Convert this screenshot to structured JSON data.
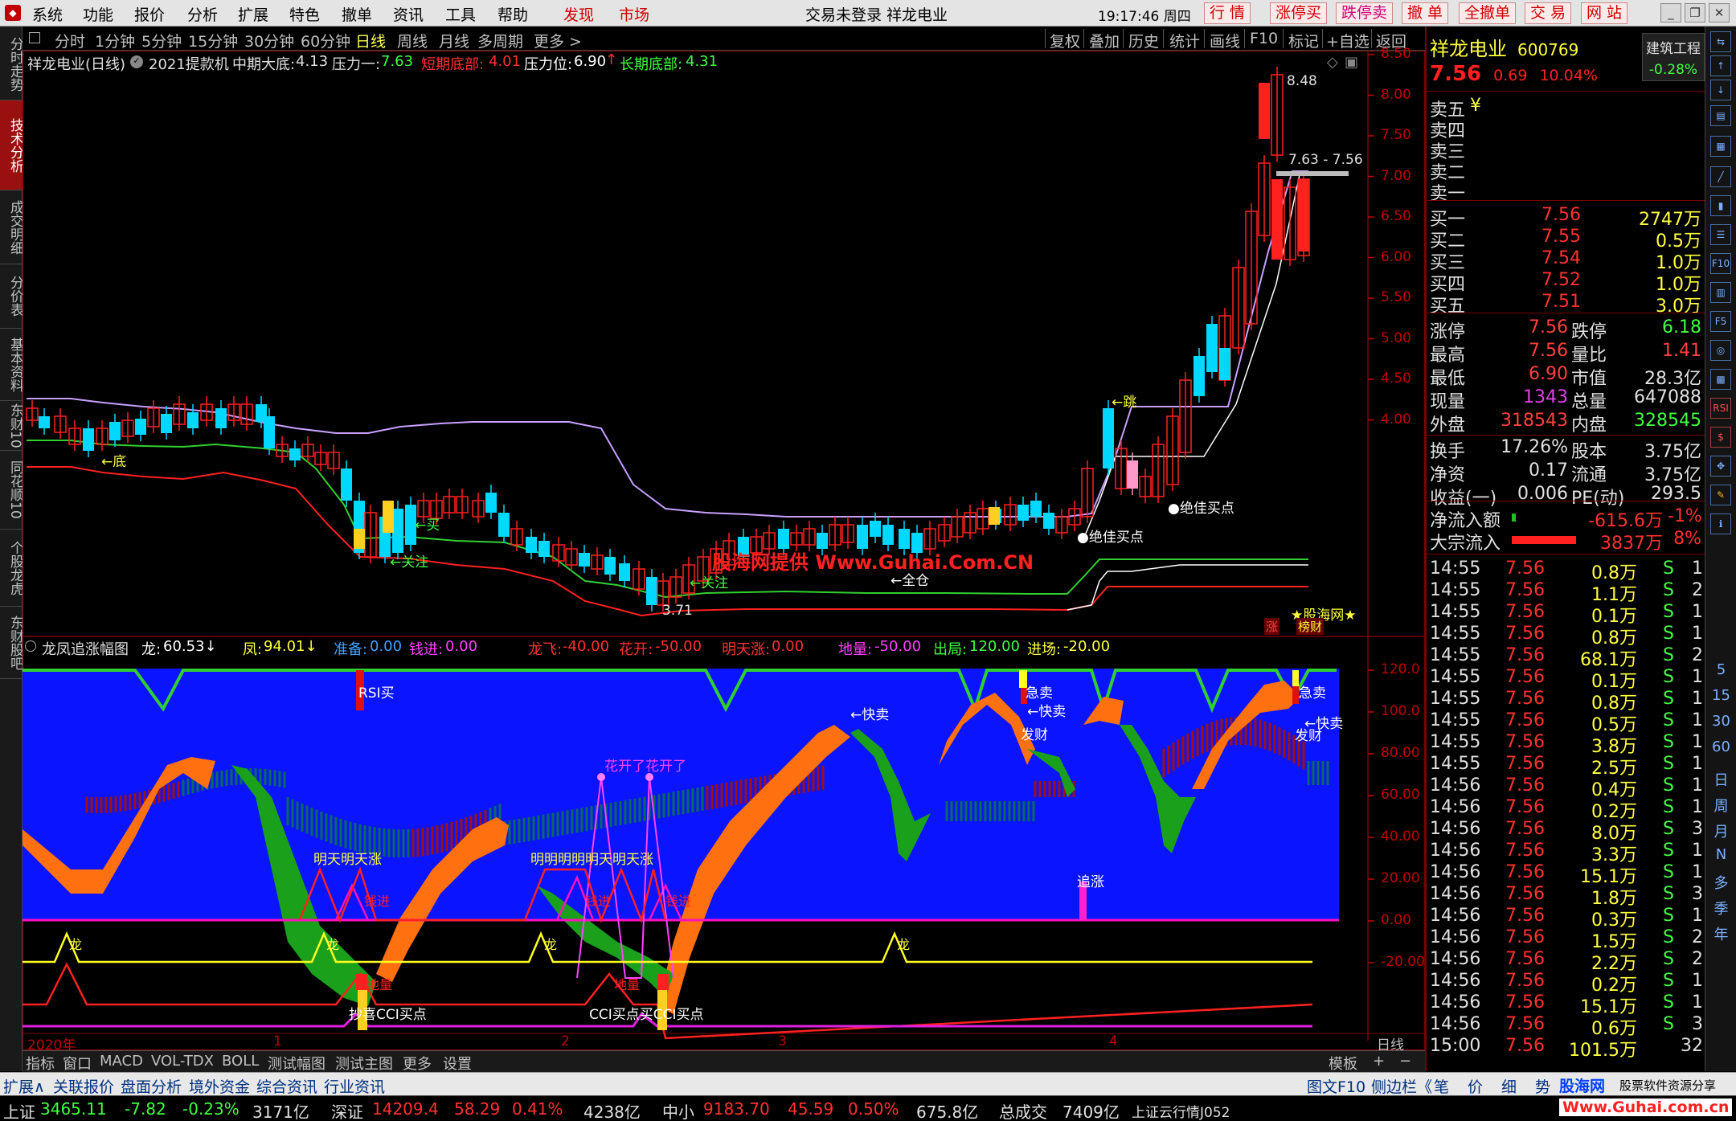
{
  "menu": {
    "items": [
      "系统",
      "功能",
      "报价",
      "分析",
      "扩展",
      "特色",
      "撤单",
      "资讯",
      "工具",
      "帮助"
    ],
    "hot": [
      "发现",
      "市场"
    ],
    "title": "交易未登录  祥龙电业",
    "time": "19:17:46 周四",
    "red_buttons": [
      "行 情",
      "涨停买",
      "跌停卖",
      "撤 单",
      "全撤单",
      "交 易",
      "网 站"
    ]
  },
  "left_tabs": [
    "分时走势",
    "技术分析",
    "成交明细",
    "分价表",
    "基本资料",
    "东财10",
    "同花顺10",
    "个股龙虎",
    "东财股吧"
  ],
  "periods": [
    "分时",
    "1分钟",
    "5分钟",
    "15分钟",
    "30分钟",
    "60分钟",
    "日线",
    "周线",
    "月线",
    "多周期",
    "更多 >"
  ],
  "tools": [
    "复权",
    "叠加",
    "历史",
    "统计",
    "画线",
    "F10",
    "标记",
    "+自选",
    "返回"
  ],
  "main_chart": {
    "stock": "祥龙电业(日线)",
    "indicator": "2021提款机",
    "mid_label": "中期大底:",
    "mid_val": "4.13",
    "pressure1_label": "压力一:",
    "pressure1_val": "7.63",
    "short_label": "短期底部:",
    "short_val": "4.01",
    "pressure_label": "压力位:",
    "pressure_val": "6.90",
    "long_label": "长期底部:",
    "long_val": "4.31",
    "price_axis": [
      "8.50",
      "8.00",
      "7.50",
      "7.00",
      "6.50",
      "6.00",
      "5.50",
      "5.00",
      "4.50",
      "4.00"
    ],
    "annotations": {
      "high": "8.48",
      "low": "3.71",
      "range": "7.63 - 7.56",
      "di": "←底",
      "mai": "←买",
      "guanzhu1": "←关注",
      "guanzhu2": "←关注",
      "quancang": "←全仓",
      "tiao": "←跳",
      "buy1": "●绝佳买点",
      "buy2": "●绝佳买点",
      "watermark": "股海网提供 Www.Guhai.Com.CN",
      "zhang": "涨",
      "guhai": "★股海网★",
      "bangcai": "榜财"
    }
  },
  "sub_chart": {
    "name": "龙凤追涨幅图",
    "long_label": "龙:",
    "long_val": "60.53↓",
    "feng_label": "凤:",
    "feng_val": "94.01↓",
    "zhunbei_label": "准备:",
    "zhunbei_val": "0.00",
    "qianjin_label": "钱进:",
    "qianjin_val": "0.00",
    "longfei_label": "龙飞:",
    "longfei_val": "-40.00",
    "huakai_label": "花开:",
    "huakai_val": "-50.00",
    "mingtian_label": "明天涨:",
    "mingtian_val": "0.00",
    "diliang_label": "地量:",
    "diliang_val": "-50.00",
    "chuju_label": "出局:",
    "chuju_val": "120.00",
    "jinchang_label": "进场:",
    "jinchang_val": "-20.00",
    "axis": [
      "120.0",
      "100.0",
      "80.00",
      "60.00",
      "40.00",
      "20.00",
      "0.00",
      "-20.00"
    ],
    "texts": {
      "rsi": "RSI买",
      "kuaimai1": "←快卖",
      "kuaimai2": "←快卖",
      "kuaimai3": "←快卖",
      "jimai1": "急卖",
      "jimai2": "急卖",
      "facai1": "发财",
      "facai2": "发财",
      "huakai": "花开了花开了",
      "mingtian1": "明天明天涨",
      "mingtian2": "明明明明明天明天涨",
      "zhuizhang": "追涨",
      "cci1": "抄喜CCI买点",
      "cci2": "CCI买点买CCI买点",
      "long1": "龙",
      "long2": "龙",
      "long3": "龙",
      "long4": "龙",
      "qian1": "钱进",
      "qian2": "钱进",
      "qian3": "钱进",
      "di1": "地量",
      "di2": "地量"
    }
  },
  "time_axis": [
    "2020年",
    "1",
    "2",
    "3",
    "4"
  ],
  "time_axis_right": "日线",
  "bottom_tabs": [
    "指标",
    "窗口",
    "MACD",
    "VOL-TDX",
    "BOLL",
    "测试幅图",
    "测试主图",
    "更多",
    "设置"
  ],
  "bottom_tabs_right": [
    "模板",
    "+",
    "−"
  ],
  "quote": {
    "name": "祥龙电业",
    "code": "600769",
    "sector": "建筑工程",
    "price": "7.56",
    "change": "0.69",
    "pct": "10.04%",
    "sector_pct": "-0.28%",
    "asks": [
      {
        "label": "卖五",
        "price": "¥",
        "vol": ""
      },
      {
        "label": "卖四",
        "price": "",
        "vol": ""
      },
      {
        "label": "卖三",
        "price": "",
        "vol": ""
      },
      {
        "label": "卖二",
        "price": "",
        "vol": ""
      },
      {
        "label": "卖一",
        "price": "",
        "vol": ""
      }
    ],
    "bids": [
      {
        "label": "买一",
        "price": "7.56",
        "vol": "2747万"
      },
      {
        "label": "买二",
        "price": "7.55",
        "vol": "0.5万"
      },
      {
        "label": "买三",
        "price": "7.54",
        "vol": "1.0万"
      },
      {
        "label": "买四",
        "price": "7.52",
        "vol": "1.0万"
      },
      {
        "label": "买五",
        "price": "7.51",
        "vol": "3.0万"
      }
    ],
    "stats": [
      {
        "l1": "涨停",
        "v1": "7.56",
        "l2": "跌停",
        "v2": "6.18",
        "c1": "#ff4040",
        "c2": "#40ff40"
      },
      {
        "l1": "最高",
        "v1": "7.56",
        "l2": "量比",
        "v2": "1.41",
        "c1": "#ff4040",
        "c2": "#ff4040"
      },
      {
        "l1": "最低",
        "v1": "6.90",
        "l2": "市值",
        "v2": "28.3亿",
        "c1": "#ff4040",
        "c2": "#e0e0e0"
      },
      {
        "l1": "现量",
        "v1": "1343",
        "l2": "总量",
        "v2": "647088",
        "c1": "#e040e0",
        "c2": "#e0e0e0"
      },
      {
        "l1": "外盘",
        "v1": "318543",
        "l2": "内盘",
        "v2": "328545",
        "c1": "#ff4040",
        "c2": "#40ff40"
      },
      {
        "l1": "换手",
        "v1": "17.26%",
        "l2": "股本",
        "v2": "3.75亿",
        "c1": "#e0e0e0",
        "c2": "#e0e0e0"
      },
      {
        "l1": "净资",
        "v1": "0.17",
        "l2": "流通",
        "v2": "3.75亿",
        "c1": "#e0e0e0",
        "c2": "#e0e0e0"
      },
      {
        "l1": "收益(一)",
        "v1": "0.006",
        "l2": "PE(动)",
        "v2": "293.5",
        "c1": "#e0e0e0",
        "c2": "#e0e0e0"
      }
    ],
    "flow": [
      {
        "label": "净流入额",
        "val": "-615.6万",
        "pct": "-1%",
        "bar": 0.05,
        "barcolor": "#20c020"
      },
      {
        "label": "大宗流入",
        "val": "3837万",
        "pct": "8%",
        "bar": 0.85,
        "barcolor": "#ff2020"
      }
    ],
    "ticks": [
      [
        "14:55",
        "7.56",
        "0.8万",
        "S",
        "1"
      ],
      [
        "14:55",
        "7.56",
        "1.1万",
        "S",
        "2"
      ],
      [
        "14:55",
        "7.56",
        "0.1万",
        "S",
        "1"
      ],
      [
        "14:55",
        "7.56",
        "0.8万",
        "S",
        "1"
      ],
      [
        "14:55",
        "7.56",
        "68.1万",
        "S",
        "2"
      ],
      [
        "14:55",
        "7.56",
        "0.1万",
        "S",
        "1"
      ],
      [
        "14:55",
        "7.56",
        "0.8万",
        "S",
        "1"
      ],
      [
        "14:55",
        "7.56",
        "0.5万",
        "S",
        "1"
      ],
      [
        "14:55",
        "7.56",
        "3.8万",
        "S",
        "1"
      ],
      [
        "14:55",
        "7.56",
        "2.5万",
        "S",
        "1"
      ],
      [
        "14:56",
        "7.56",
        "0.4万",
        "S",
        "1"
      ],
      [
        "14:56",
        "7.56",
        "0.2万",
        "S",
        "1"
      ],
      [
        "14:56",
        "7.56",
        "8.0万",
        "S",
        "3"
      ],
      [
        "14:56",
        "7.56",
        "3.3万",
        "S",
        "1"
      ],
      [
        "14:56",
        "7.56",
        "15.1万",
        "S",
        "1"
      ],
      [
        "14:56",
        "7.56",
        "1.8万",
        "S",
        "3"
      ],
      [
        "14:56",
        "7.56",
        "0.3万",
        "S",
        "1"
      ],
      [
        "14:56",
        "7.56",
        "1.5万",
        "S",
        "2"
      ],
      [
        "14:56",
        "7.56",
        "2.2万",
        "S",
        "2"
      ],
      [
        "14:56",
        "7.56",
        "0.2万",
        "S",
        "1"
      ],
      [
        "14:56",
        "7.56",
        "15.1万",
        "S",
        "1"
      ],
      [
        "14:56",
        "7.56",
        "0.6万",
        "S",
        "3"
      ],
      [
        "15:00",
        "7.56",
        "101.5万",
        "",
        "32"
      ]
    ]
  },
  "right_labels": [
    "5",
    "15",
    "30",
    "60",
    "日",
    "周",
    "月",
    "N",
    "多",
    "季",
    "年"
  ],
  "right_icon_labels": [
    "F10",
    "F5",
    "RSI"
  ],
  "func_bar": {
    "items": [
      "扩展∧",
      "关联报价",
      "盘面分析",
      "境外资金",
      "综合资讯",
      "行业资讯"
    ],
    "right": [
      "图文F10",
      "侧边栏《",
      "笔",
      "价",
      "细",
      "势"
    ],
    "watermark1": "股海网",
    "watermark2": "Www.Guhai.com.cn",
    "watermark3": "股票软件资源分享"
  },
  "status": {
    "sh_label": "上证",
    "sh_val": "3465.11",
    "sh_chg": "-7.82",
    "sh_pct": "-0.23%",
    "sh_amt": "3171亿",
    "sz_label": "深证",
    "sz_val": "14209.4",
    "sz_chg": "58.29",
    "sz_pct": "0.41%",
    "sz_amt": "4238亿",
    "zx_label": "中小",
    "zx_val": "9183.70",
    "zx_chg": "45.59",
    "zx_pct": "0.50%",
    "zx_amt": "675.8亿",
    "total_label": "总成交",
    "total_val": "7409亿",
    "cloud": "上证云行情J052"
  },
  "colors": {
    "up": "#ff2020",
    "down": "#00e0ff",
    "bg": "#000000",
    "frame": "#7a0000",
    "sub_bg": "#0a14ff"
  }
}
